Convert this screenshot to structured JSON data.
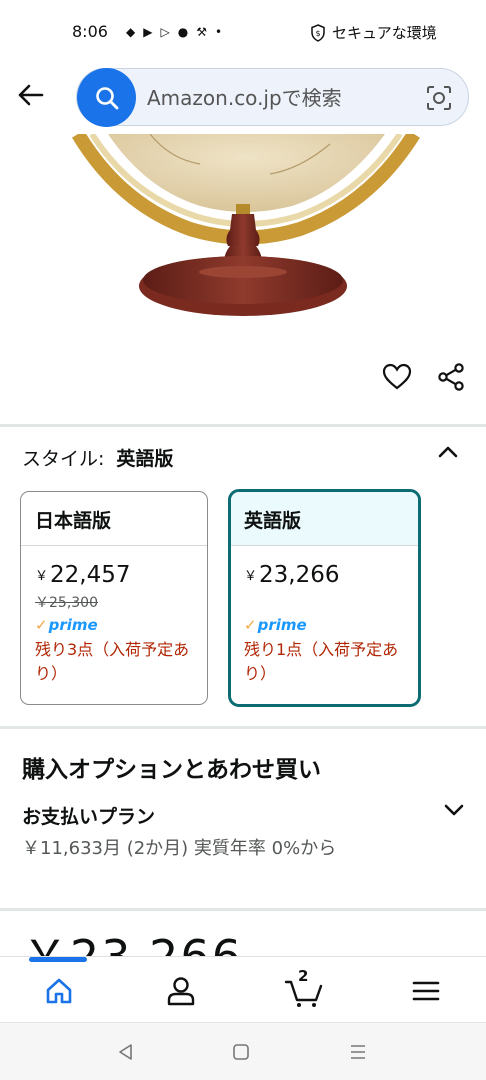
{
  "status_bar": {
    "time": "8:06",
    "security_label": "セキュアな環境"
  },
  "search": {
    "placeholder": "Amazon.co.jpで検索"
  },
  "style_selector": {
    "label": "スタイル:",
    "selected_value": "英語版",
    "variants": [
      {
        "name": "日本語版",
        "currency": "￥",
        "price": "22,457",
        "list_price": "￥25,300",
        "prime": "prime",
        "stock": "残り3点（入荷予定あり）",
        "selected": false
      },
      {
        "name": "英語版",
        "currency": "￥",
        "price": "23,266",
        "list_price": "",
        "prime": "prime",
        "stock": "残り1点（入荷予定あり）",
        "selected": true
      }
    ]
  },
  "purchase_options": {
    "title": "購入オプションとあわせ買い",
    "plan_title": "お支払いプラン",
    "plan_detail": "￥11,633月 (2か月) 実質年率 0%から"
  },
  "partial_price": "￥23,266",
  "bottom_nav": {
    "cart_count": "2"
  },
  "colors": {
    "search_accent": "#1a73e8",
    "selected_border": "#0b6d73",
    "stock_text": "#b12704",
    "prime_blue": "#1a98ff"
  },
  "icons": {
    "back": "arrow-left-icon",
    "search": "search-icon",
    "camera": "camera-scan-icon",
    "wishlist": "heart-icon",
    "share": "share-icon",
    "collapse": "chevron-up-icon",
    "expand": "chevron-down-icon",
    "home": "home-icon",
    "account": "person-icon",
    "cart": "cart-icon",
    "menu": "hamburger-menu-icon"
  }
}
